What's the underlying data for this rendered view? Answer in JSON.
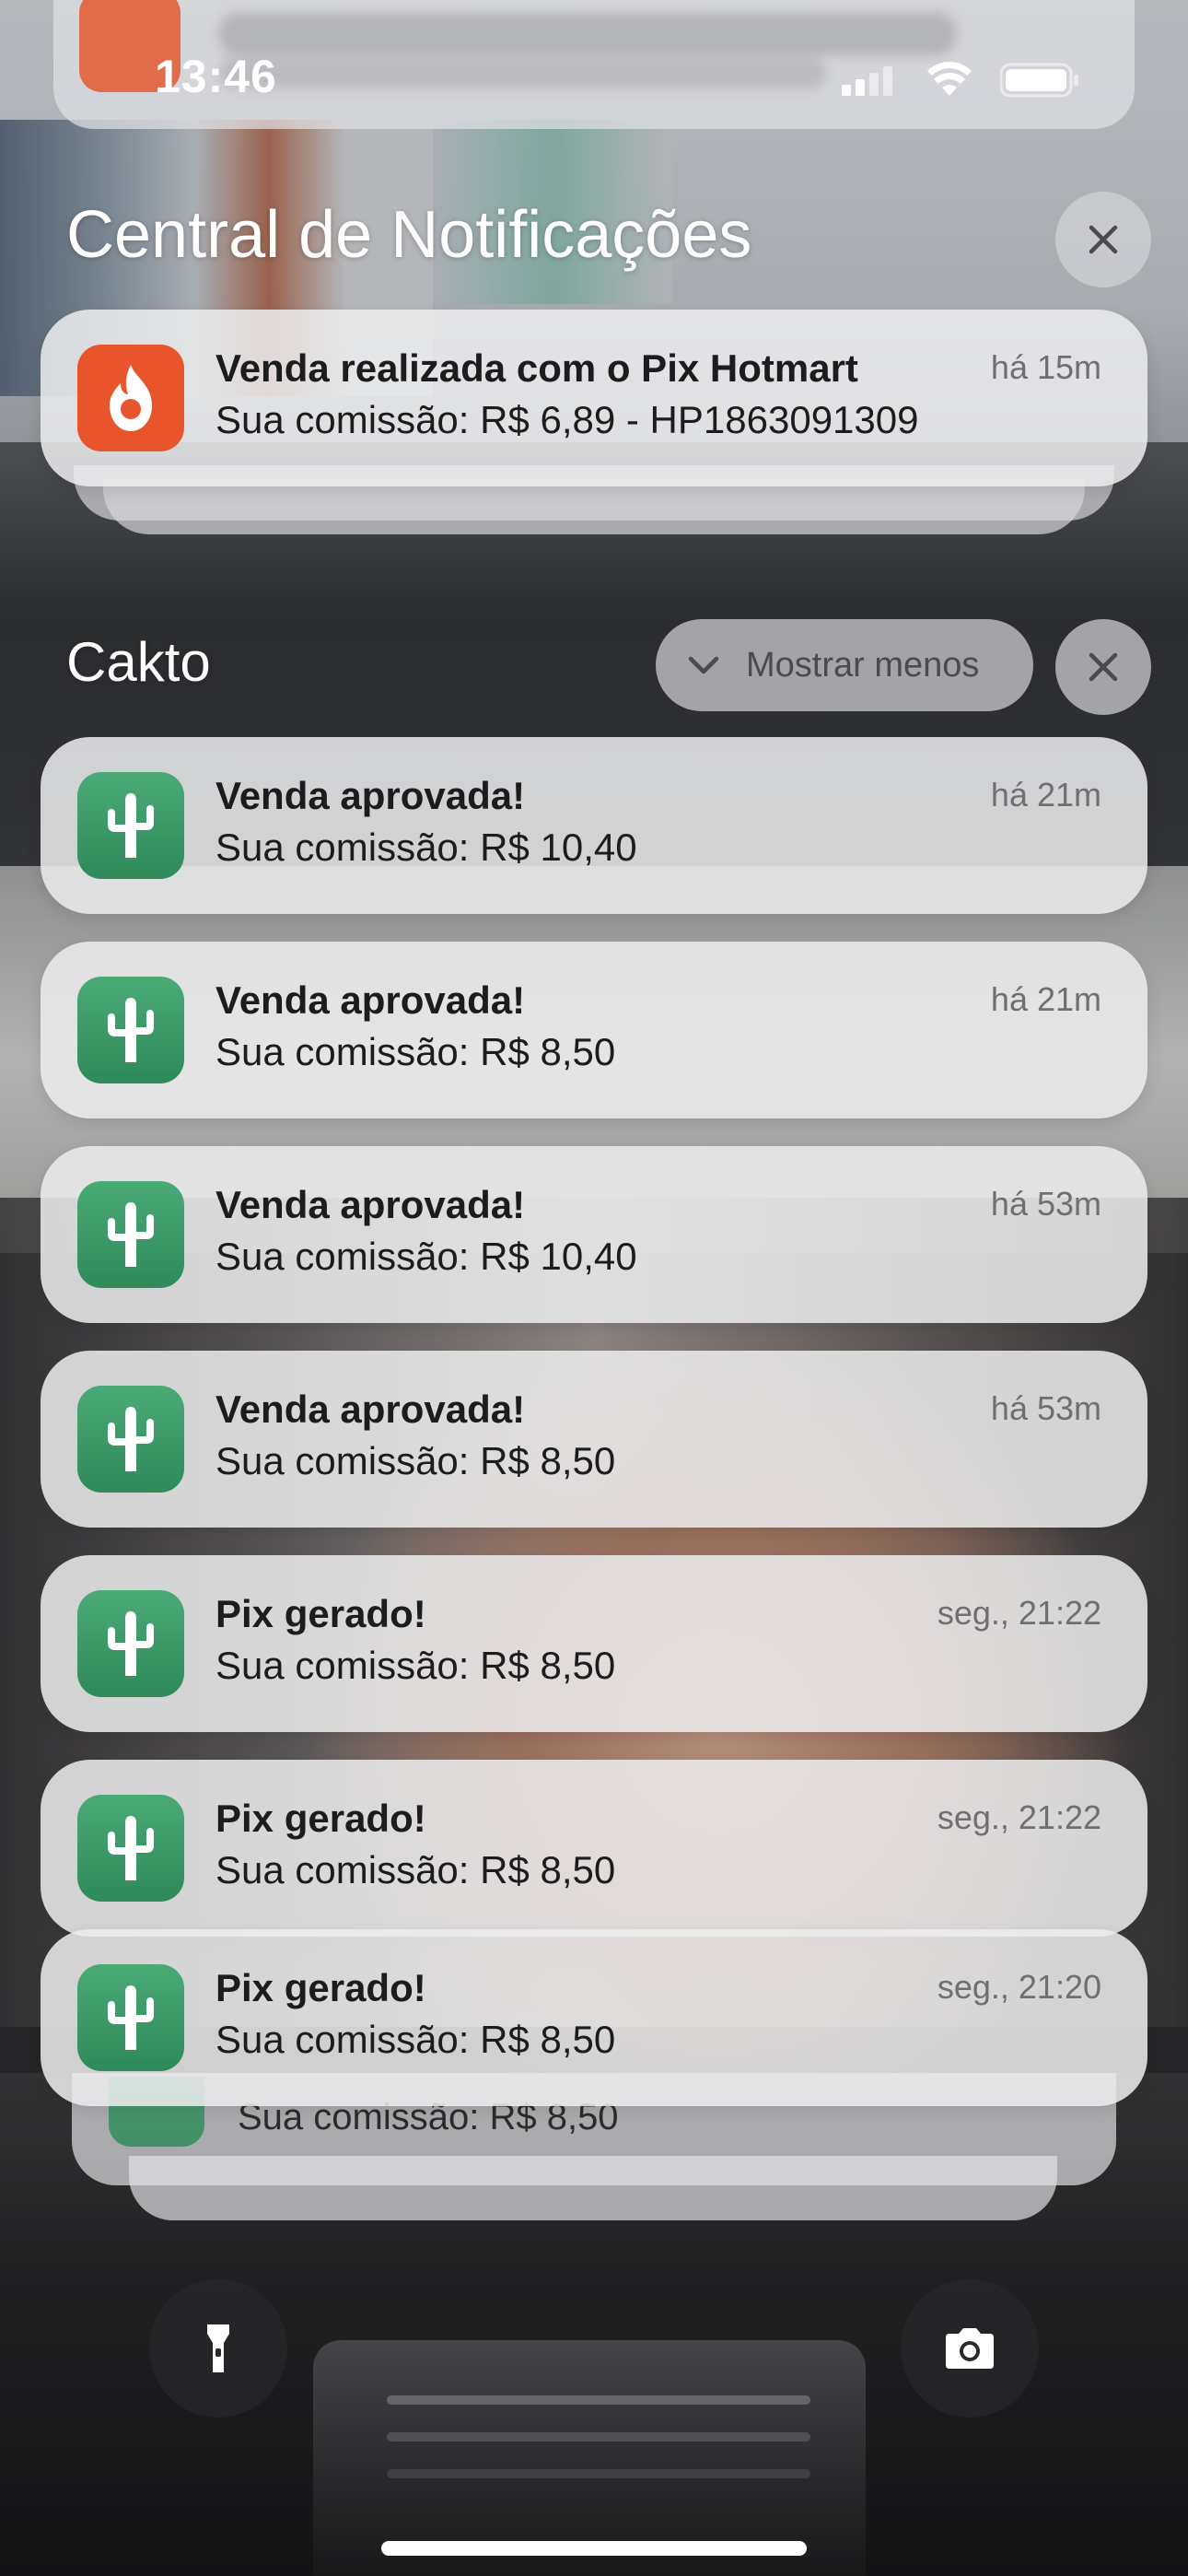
{
  "status_bar": {
    "time": "13:46"
  },
  "header": {
    "title": "Central de Notificações"
  },
  "hotmart_notification": {
    "title": "Venda realizada com o Pix Hotmart",
    "body": "Sua comissão: R$ 6,89 - HP1863091309",
    "time": "há 15m",
    "icon": "hotmart-flame-icon",
    "icon_color": "#e8552c"
  },
  "cakto_group": {
    "app_name": "Cakto",
    "show_less_label": "Mostrar menos",
    "icon": "cactus-icon",
    "icon_color": "#3d9a68",
    "notifications": [
      {
        "title": "Venda aprovada!",
        "body": "Sua comissão: R$ 10,40",
        "time": "há 21m"
      },
      {
        "title": "Venda aprovada!",
        "body": "Sua comissão: R$ 8,50",
        "time": "há 21m"
      },
      {
        "title": "Venda aprovada!",
        "body": "Sua comissão: R$ 10,40",
        "time": "há 53m"
      },
      {
        "title": "Venda aprovada!",
        "body": "Sua comissão: R$ 8,50",
        "time": "há 53m"
      },
      {
        "title": "Pix gerado!",
        "body": "Sua comissão: R$ 8,50",
        "time": "seg., 21:22"
      },
      {
        "title": "Pix gerado!",
        "body": "Sua comissão: R$ 8,50",
        "time": "seg., 21:22"
      },
      {
        "title": "Pix gerado!",
        "body": "Sua comissão: R$ 8,50",
        "time": "seg., 21:20"
      }
    ],
    "overflow_body": "Sua comissão: R$ 8,50"
  },
  "bottom_controls": {
    "left": "flashlight-icon",
    "right": "camera-icon"
  }
}
